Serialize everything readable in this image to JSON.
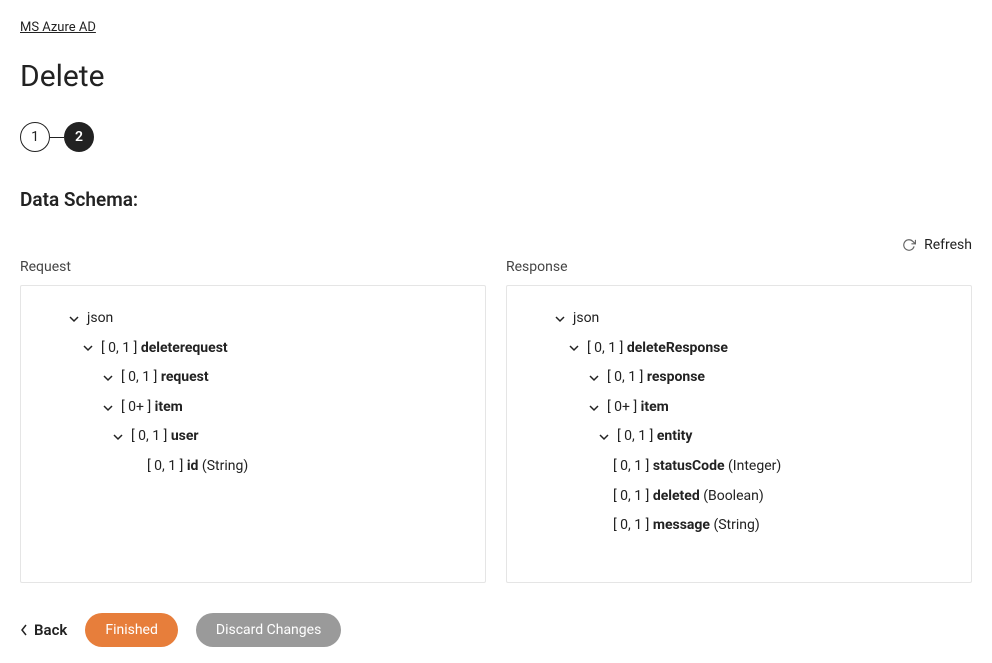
{
  "breadcrumb": "MS Azure AD",
  "title": "Delete",
  "stepper": {
    "step1": "1",
    "step2": "2"
  },
  "sectionTitle": "Data Schema:",
  "refresh": "Refresh",
  "request": {
    "label": "Request",
    "root": "json",
    "n1": {
      "card": "[ 0, 1 ]",
      "name": "deleterequest"
    },
    "n2": {
      "card": "[ 0, 1 ]",
      "name": "request"
    },
    "n3": {
      "card": "[ 0+ ]",
      "name": "item"
    },
    "n4": {
      "card": "[ 0, 1 ]",
      "name": "user"
    },
    "n5": {
      "card": "[ 0, 1 ]",
      "name": "id",
      "type": "(String)"
    }
  },
  "response": {
    "label": "Response",
    "root": "json",
    "n1": {
      "card": "[ 0, 1 ]",
      "name": "deleteResponse"
    },
    "n2": {
      "card": "[ 0, 1 ]",
      "name": "response"
    },
    "n3": {
      "card": "[ 0+ ]",
      "name": "item"
    },
    "n4": {
      "card": "[ 0, 1 ]",
      "name": "entity"
    },
    "n5": {
      "card": "[ 0, 1 ]",
      "name": "statusCode",
      "type": "(Integer)"
    },
    "n6": {
      "card": "[ 0, 1 ]",
      "name": "deleted",
      "type": "(Boolean)"
    },
    "n7": {
      "card": "[ 0, 1 ]",
      "name": "message",
      "type": "(String)"
    }
  },
  "footer": {
    "back": "Back",
    "finished": "Finished",
    "discard": "Discard Changes"
  }
}
